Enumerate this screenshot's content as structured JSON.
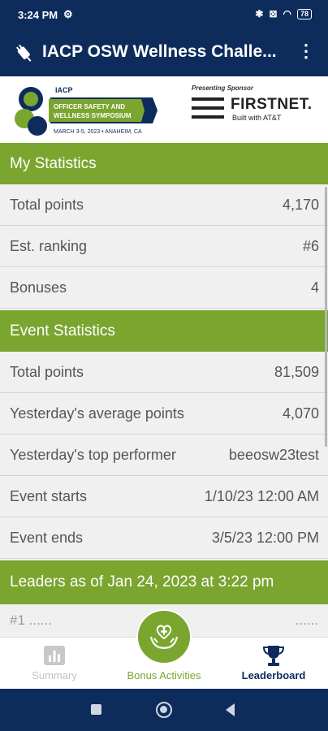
{
  "status_bar": {
    "time": "3:24 PM",
    "battery": "78"
  },
  "app_bar": {
    "title": "IACP OSW Wellness Challe..."
  },
  "banner": {
    "event_org": "IACP",
    "event_name_line1": "OFFICER SAFETY AND",
    "event_name_line2": "WELLNESS SYMPOSIUM",
    "event_dates": "MARCH 3-5, 2023 • ANAHEIM, CA",
    "sponsor_label": "Presenting Sponsor",
    "sponsor_name": "FIRSTNET.",
    "sponsor_sub": "Built with AT&T"
  },
  "my_statistics": {
    "title": "My Statistics",
    "rows": [
      {
        "label": "Total points",
        "value": "4,170"
      },
      {
        "label": "Est. ranking",
        "value": "#6"
      },
      {
        "label": "Bonuses",
        "value": "4"
      }
    ]
  },
  "event_statistics": {
    "title": "Event Statistics",
    "rows": [
      {
        "label": "Total points",
        "value": "81,509"
      },
      {
        "label": "Yesterday's average points",
        "value": "4,070"
      },
      {
        "label": "Yesterday's top performer",
        "value": "beeosw23test"
      },
      {
        "label": "Event starts",
        "value": "1/10/23 12:00 AM"
      },
      {
        "label": "Event ends",
        "value": "3/5/23 12:00 PM"
      }
    ]
  },
  "leaders": {
    "title": "Leaders as of Jan 24, 2023 at 3:22 pm"
  },
  "bottom_nav": {
    "summary": "Summary",
    "bonus": "Bonus Activities",
    "leaderboard": "Leaderboard"
  },
  "colors": {
    "primary": "#0d2c5c",
    "accent": "#7aa52f",
    "background": "#f0f0f0"
  }
}
